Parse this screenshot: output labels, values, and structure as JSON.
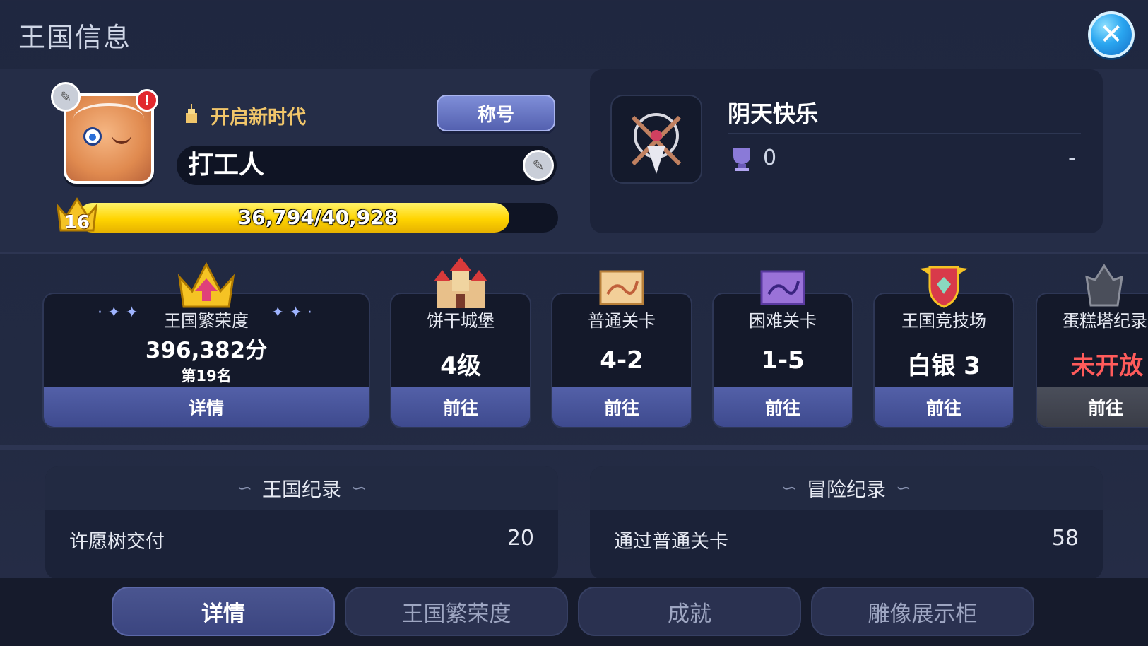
{
  "header": {
    "title": "王国信息",
    "close_label": "✕"
  },
  "profile": {
    "title_name": "开启新时代",
    "title_button": "称号",
    "player_name": "打工人",
    "level": "16",
    "xp_text": "36,794/40,928",
    "xp_current": 36794,
    "xp_max": 40928,
    "alert_mark": "!"
  },
  "guild": {
    "name": "阴天快乐",
    "trophies": "0",
    "rank": "-"
  },
  "cards": [
    {
      "label": "王国繁荣度",
      "value": "396,382分",
      "sub": "第19名",
      "button": "详情"
    },
    {
      "label": "饼干城堡",
      "value": "4级",
      "button": "前往"
    },
    {
      "label": "普通关卡",
      "value": "4-2",
      "button": "前往"
    },
    {
      "label": "困难关卡",
      "value": "1-5",
      "button": "前往"
    },
    {
      "label": "王国竞技场",
      "value": "白银 3",
      "button": "前往"
    },
    {
      "label": "蛋糕塔纪录",
      "value": "未开放",
      "button": "前往"
    }
  ],
  "kingdom_records": {
    "title": "王国纪录",
    "rows": [
      {
        "label": "许愿树交付",
        "value": "20"
      }
    ]
  },
  "adventure_records": {
    "title": "冒险纪录",
    "rows": [
      {
        "label": "通过普通关卡",
        "value": "58"
      }
    ]
  },
  "tabs": [
    {
      "label": "详情",
      "active": true
    },
    {
      "label": "王国繁荣度",
      "active": false
    },
    {
      "label": "成就",
      "active": false
    },
    {
      "label": "雕像展示柜",
      "active": false
    }
  ],
  "colors": {
    "background": "#1f2740",
    "xp_fill": "#ffd400",
    "title_gold": "#f0c56a",
    "closed_red": "#ff5b5b",
    "button_blue": "#4a5590"
  }
}
